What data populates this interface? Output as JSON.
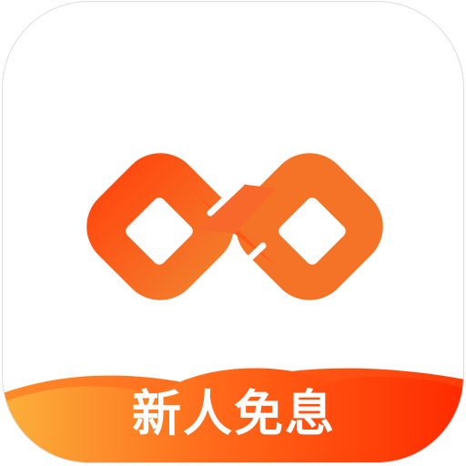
{
  "app_icon": {
    "logo_icon": "infinity-logo-icon",
    "promo_text": "新人免息",
    "colors": {
      "logo_start": "#ff4a10",
      "logo_end": "#f47a2a",
      "banner_left": "#fbb03b",
      "banner_mid": "#ff5a1a",
      "banner_right": "#ff2a00",
      "banner_back": "#ff3c0a",
      "text": "#ffffff",
      "tile_border": "#dcdcdc"
    }
  }
}
